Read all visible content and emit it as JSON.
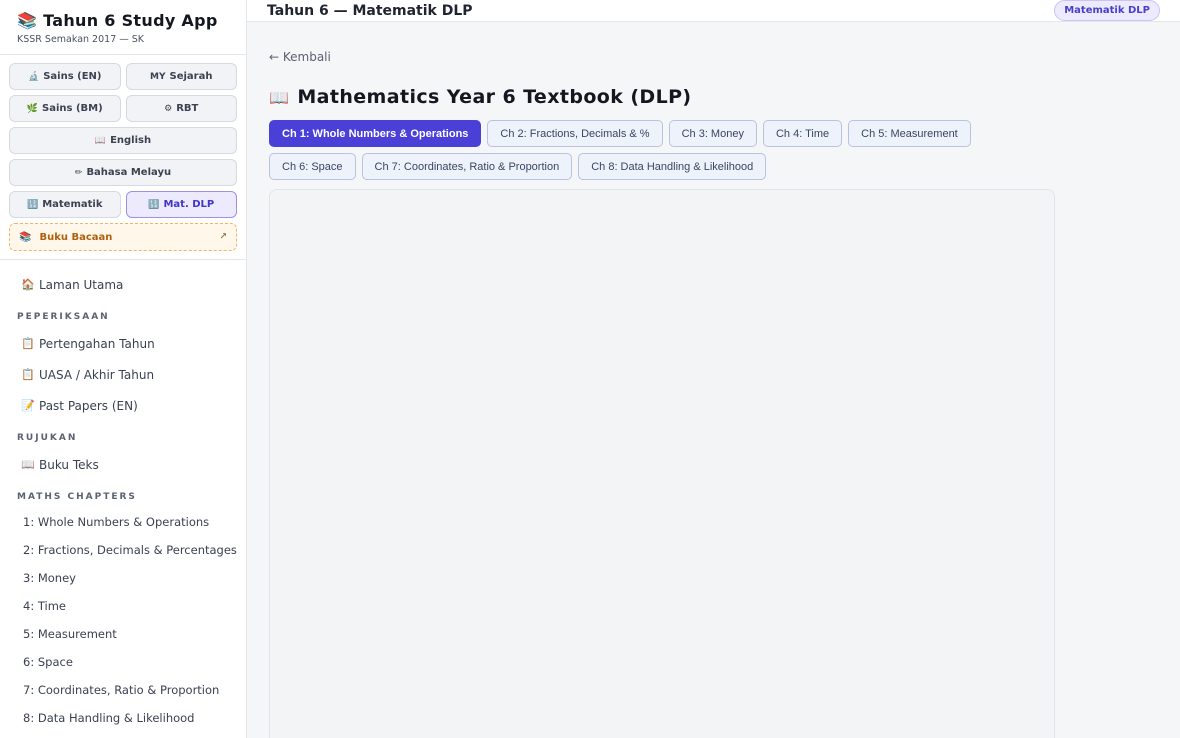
{
  "brand": {
    "title": "Tahun 6 Study App",
    "icon": "books-icon",
    "subtitle": "KSSR Semakan 2017 — SK"
  },
  "subjects": {
    "rows": [
      [
        {
          "label": "Sains (EN)",
          "glyph": "🔬",
          "active": false
        },
        {
          "label": "Sejarah",
          "glyph": "MY",
          "active": false
        }
      ],
      [
        {
          "label": "Sains (BM)",
          "glyph": "🌿",
          "active": false
        },
        {
          "label": "RBT",
          "glyph": "⚙",
          "active": false
        }
      ],
      [
        {
          "label": "English",
          "glyph": "📖",
          "active": false
        }
      ],
      [
        {
          "label": "Bahasa Melayu",
          "glyph": "✏",
          "active": false
        }
      ],
      [
        {
          "label": "Matematik",
          "glyph": "🔢",
          "active": false
        },
        {
          "label": "Mat. DLP",
          "glyph": "🔢",
          "active": true
        }
      ]
    ],
    "buku_bacaan": {
      "label": "Buku Bacaan",
      "glyph": "📚",
      "ext": "↗"
    }
  },
  "nav": {
    "home": {
      "label": "Laman Utama",
      "glyph": "🏠"
    },
    "sections": {
      "exams": "PEPERIKSAAN",
      "reference": "RUJUKAN",
      "chapters": "MATHS CHAPTERS"
    },
    "exam_items": [
      {
        "label": "Pertengahan Tahun",
        "glyph": "📋"
      },
      {
        "label": "UASA / Akhir Tahun",
        "glyph": "📋"
      },
      {
        "label": "Past Papers (EN)",
        "glyph": "📝"
      }
    ],
    "reference_items": [
      {
        "label": "Buku Teks",
        "glyph": "📖"
      }
    ],
    "chapter_items": [
      "1: Whole Numbers & Operations",
      "2: Fractions, Decimals & Percentages",
      "3: Money",
      "4: Time",
      "5: Measurement",
      "6: Space",
      "7: Coordinates, Ratio & Proportion",
      "8: Data Handling & Likelihood"
    ]
  },
  "topbar": {
    "title": "Tahun 6 — Matematik DLP",
    "badge": "Matematik DLP"
  },
  "main": {
    "back": "← Kembali",
    "title": "Mathematics Year 6 Textbook (DLP)",
    "title_glyph": "📖",
    "tabs": [
      {
        "label": "Ch 1: Whole Numbers & Operations",
        "active": true
      },
      {
        "label": "Ch 2: Fractions, Decimals & %",
        "active": false
      },
      {
        "label": "Ch 3: Money",
        "active": false
      },
      {
        "label": "Ch 4: Time",
        "active": false
      },
      {
        "label": "Ch 5: Measurement",
        "active": false
      },
      {
        "label": "Ch 6: Space",
        "active": false
      },
      {
        "label": "Ch 7: Coordinates, Ratio & Proportion",
        "active": false
      },
      {
        "label": "Ch 8: Data Handling & Likelihood",
        "active": false
      }
    ]
  },
  "colors": {
    "accent": "#4a3fd6",
    "accent_soft": "#eceafc",
    "warning_soft": "#fff7ea"
  }
}
